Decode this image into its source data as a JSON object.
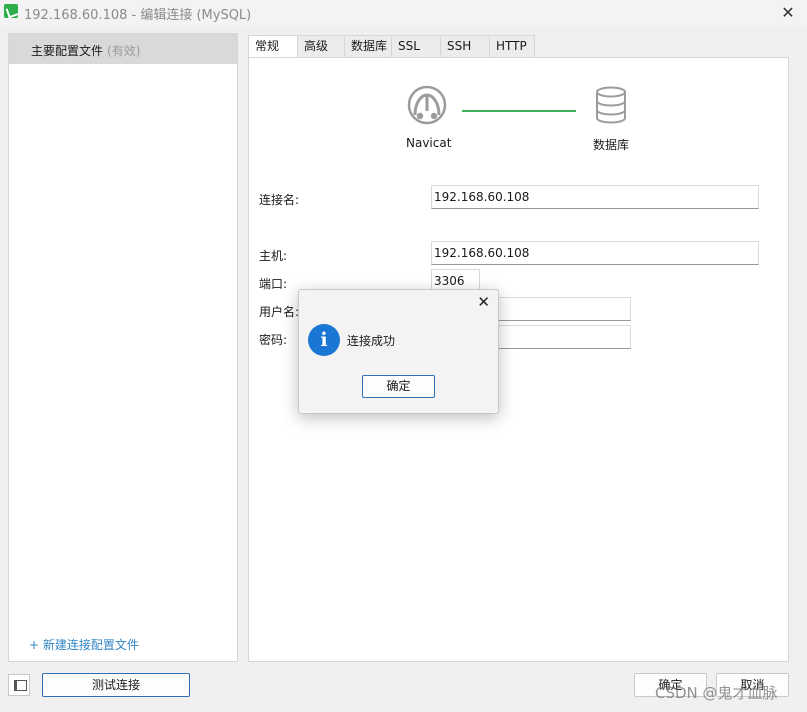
{
  "window": {
    "title": "192.168.60.108 - 编辑连接 (MySQL)",
    "close_glyph": "✕"
  },
  "sidebar": {
    "profile_name": "主要配置文件",
    "profile_status": "(有效)",
    "new_profile_link": "+ 新建连接配置文件"
  },
  "tabs": [
    {
      "label": "常规",
      "active": true
    },
    {
      "label": "高级",
      "active": false
    },
    {
      "label": "数据库",
      "active": false
    },
    {
      "label": "SSL",
      "active": false
    },
    {
      "label": "SSH",
      "active": false
    },
    {
      "label": "HTTP",
      "active": false
    }
  ],
  "diagram": {
    "navicat_label": "Navicat",
    "database_label": "数据库",
    "line_color": "#3cb25a"
  },
  "form": {
    "connection_name_label": "连接名:",
    "connection_name_value": "192.168.60.108",
    "host_label": "主机:",
    "host_value": "192.168.60.108",
    "port_label": "端口:",
    "port_value": "3306",
    "username_label": "用户名:",
    "username_value": "",
    "password_label": "密码:",
    "password_value": ""
  },
  "dialog": {
    "message": "连接成功",
    "ok_label": "确定",
    "close_glyph": "✕",
    "icon": "info-icon",
    "icon_glyph": "i",
    "icon_color": "#1976d2"
  },
  "footer": {
    "test_connection_label": "测试连接",
    "ok_label": "确定",
    "cancel_label": "取消"
  },
  "watermark": "CSDN @鬼才血脉"
}
